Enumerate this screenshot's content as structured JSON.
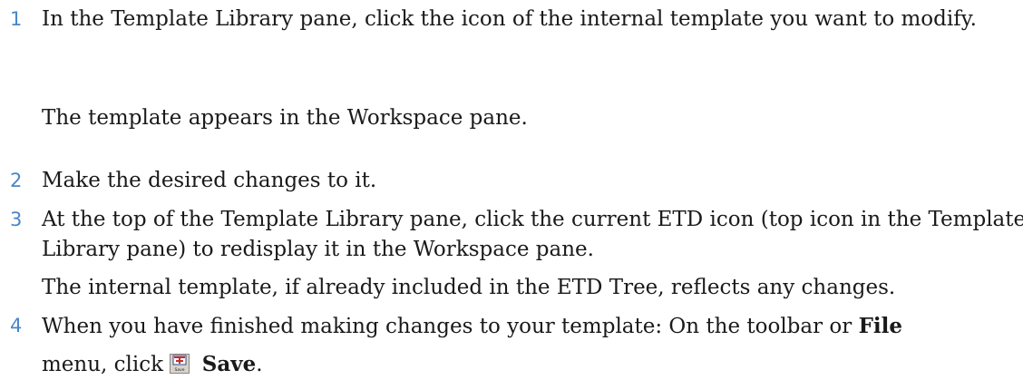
{
  "steps": [
    {
      "number": "1",
      "text": "In the Template Library pane, click the icon of the internal template you want to modify.",
      "result": "The template appears in the Workspace pane."
    },
    {
      "number": "2",
      "text": "Make the desired changes to it."
    },
    {
      "number": "3",
      "text": "At the top of the Template Library pane, click the current ETD icon (top icon in the Template Library pane) to redisplay it in the Workspace pane.",
      "result": "The internal template, if already included in the ETD Tree, reflects any changes."
    },
    {
      "number": "4",
      "text_before": "When you have finished making changes to your template: On the toolbar or",
      "file_label": "File",
      "text_after": "menu, click",
      "save_label": "Save",
      "end": "."
    }
  ],
  "icons": {
    "save_icon": "save-icon",
    "save_icon_caption": "Save"
  },
  "colors": {
    "step_number": "#4a86c8"
  }
}
